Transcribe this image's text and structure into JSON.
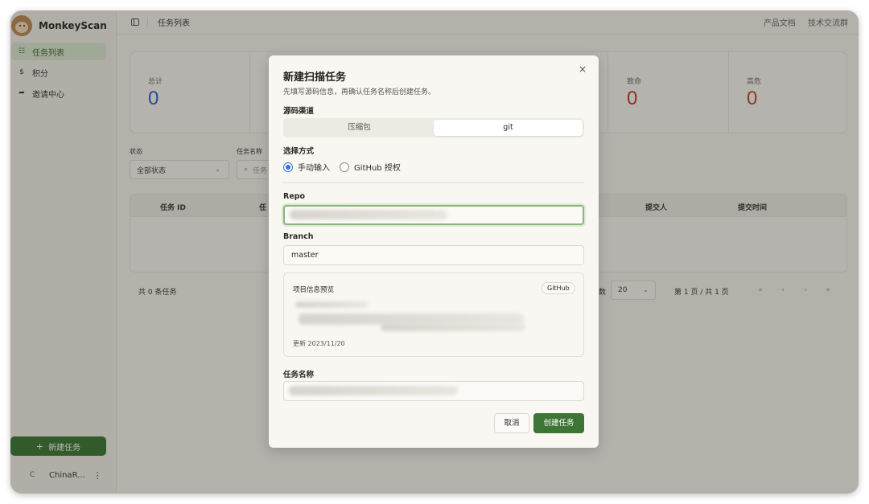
{
  "app": {
    "name": "MonkeyScan"
  },
  "sidebar": {
    "items": [
      {
        "label": "任务列表",
        "icon": "list-icon",
        "active": true
      },
      {
        "label": "积分",
        "icon": "coin-icon",
        "active": false
      },
      {
        "label": "邀请中心",
        "icon": "share-icon",
        "active": false
      }
    ],
    "new_task": "新建任务",
    "user": {
      "avatar": "C",
      "name": "ChinaR..."
    }
  },
  "topbar": {
    "breadcrumb": "任务列表",
    "links": [
      "产品文档",
      "技术交流群"
    ]
  },
  "stats": [
    {
      "label": "总计",
      "value": "0",
      "color": "#2f5fd0"
    },
    {
      "label": "致命",
      "value": "0",
      "color": "#c43a2b"
    },
    {
      "label": "高危",
      "value": "0",
      "color": "#c4472b"
    }
  ],
  "filters": {
    "status_label": "状态",
    "status_value": "全部状态",
    "name_label": "任务名称",
    "name_placeholder": "任务"
  },
  "table": {
    "columns": [
      "任务 ID",
      "任",
      "提交人",
      "提交时间"
    ]
  },
  "pager": {
    "count": "共 0 条任务",
    "size_label": "数",
    "size_value": "20",
    "page_info": "第 1 页 / 共 1 页",
    "buttons": [
      "«",
      "‹",
      "›",
      "»"
    ]
  },
  "modal": {
    "title": "新建扫描任务",
    "subtitle": "先填写源码信息，再确认任务名称后创建任务。",
    "close": "×",
    "source_label": "源码渠道",
    "source_options": [
      "压缩包",
      "git"
    ],
    "source_selected": "git",
    "method_label": "选择方式",
    "methods": [
      "手动输入",
      "GitHub 授权"
    ],
    "method_selected": "手动输入",
    "repo_label": "Repo",
    "branch_label": "Branch",
    "branch_value": "master",
    "preview_title": "项目信息预览",
    "preview_badge": "GitHub",
    "preview_updated": "更新 2023/11/20",
    "task_name_label": "任务名称",
    "cancel": "取消",
    "create": "创建任务"
  },
  "colors": {
    "accent": "#3d7634",
    "radio": "#2f6fe0"
  }
}
